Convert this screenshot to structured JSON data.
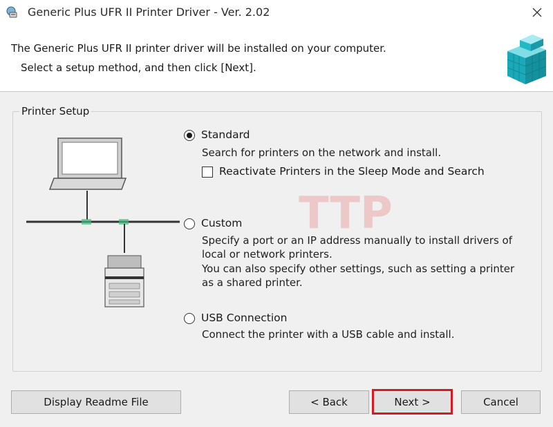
{
  "window": {
    "title": "Generic Plus UFR II Printer Driver - Ver. 2.02",
    "close_icon": "close-icon",
    "app_icon": "printer-setup-icon"
  },
  "header": {
    "line1": "The Generic Plus UFR II printer driver will be installed on your computer.",
    "line2": "Select a setup method, and then click [Next].",
    "logo_icon": "cube-stack-logo"
  },
  "group": {
    "label": "Printer Setup"
  },
  "options": {
    "standard": {
      "label": "Standard",
      "checked": true,
      "description": "Search for printers on the network and install.",
      "sleep_mode_checkbox_label": "Reactivate Printers in the Sleep Mode and Search",
      "sleep_mode_checked": false
    },
    "custom": {
      "label": "Custom",
      "checked": false,
      "description_lines": [
        "Specify a port or an IP address manually to install drivers of",
        "local or network printers.",
        "You can also specify other settings, such as setting a printer",
        "as a shared printer."
      ]
    },
    "usb": {
      "label": "USB Connection",
      "checked": false,
      "description": "Connect the printer with a USB cable and install."
    }
  },
  "watermark_text": "TTP",
  "buttons": {
    "readme": "Display Readme File",
    "back": "< Back",
    "next": "Next >",
    "cancel": "Cancel"
  },
  "colors": {
    "highlight_border": "#d71920",
    "logo_teal": "#1fb5c4",
    "watermark_red": "#e0191f"
  }
}
